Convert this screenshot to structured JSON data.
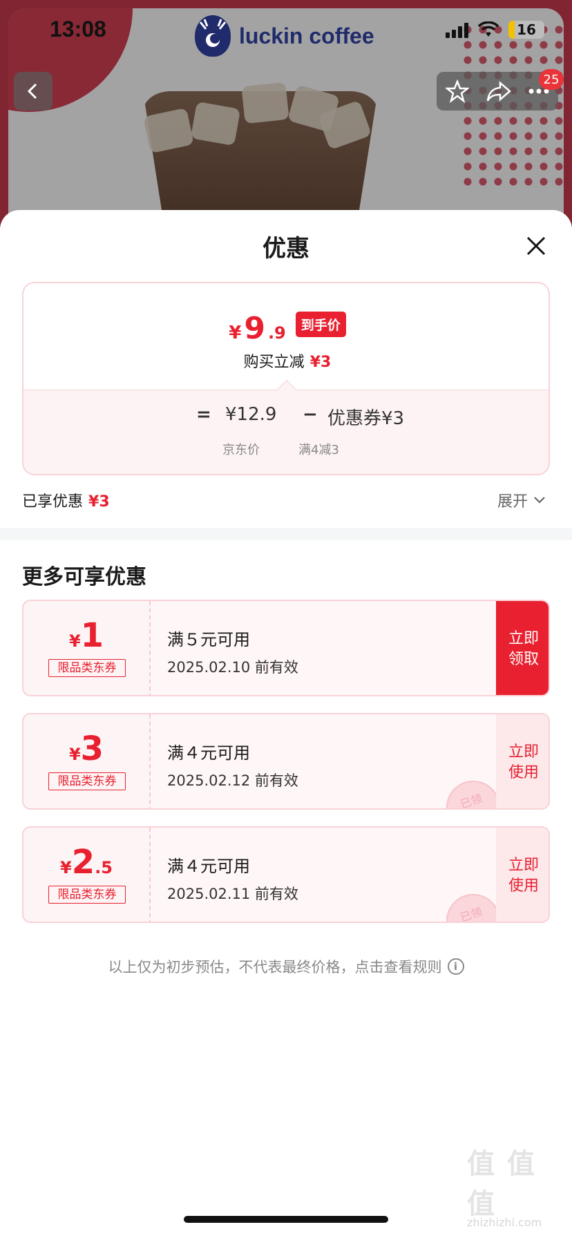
{
  "status_bar": {
    "time": "13:08",
    "battery": "16"
  },
  "header": {
    "brand": "luckin coffee",
    "cart_badge": "25"
  },
  "sheet": {
    "title": "优惠",
    "summary": {
      "final_currency": "¥",
      "final_int": "9",
      "final_dec": ".9",
      "final_tag": "到手价",
      "reduce_label": "购买立减",
      "reduce_value": "¥3",
      "eq_sign": "=",
      "base_price": "¥12.9",
      "minus_sign": "−",
      "coupon_value": "优惠券¥3",
      "base_label": "京东价",
      "coupon_label": "满4减3"
    },
    "enjoyed_label": "已享优惠",
    "enjoyed_value": "¥3",
    "expand_label": "展开",
    "more_title": "更多可享优惠",
    "coupons": [
      {
        "currency": "¥",
        "int": "1",
        "dec": "",
        "type": "限品类东券",
        "condition": "满５元可用",
        "expiry": "2025.02.10 前有效",
        "action_line1": "立即",
        "action_line2": "领取",
        "claimed": ""
      },
      {
        "currency": "¥",
        "int": "3",
        "dec": "",
        "type": "限品类东券",
        "condition": "满４元可用",
        "expiry": "2025.02.12 前有效",
        "action_line1": "立即",
        "action_line2": "使用",
        "claimed": "已领"
      },
      {
        "currency": "¥",
        "int": "2",
        "dec": ".5",
        "type": "限品类东券",
        "condition": "满４元可用",
        "expiry": "2025.02.11 前有效",
        "action_line1": "立即",
        "action_line2": "使用",
        "claimed": "已领"
      }
    ],
    "footnote": "以上仅为初步预估，不代表最终价格，点击查看规则",
    "info_icon_glyph": "i"
  },
  "watermark": {
    "main": "值 值 值",
    "sub": "zhizhizhi.com"
  },
  "colors": {
    "accent_red": "#e8202f",
    "card_border": "#f8d2d7",
    "brand_navy": "#1f2b6a"
  }
}
